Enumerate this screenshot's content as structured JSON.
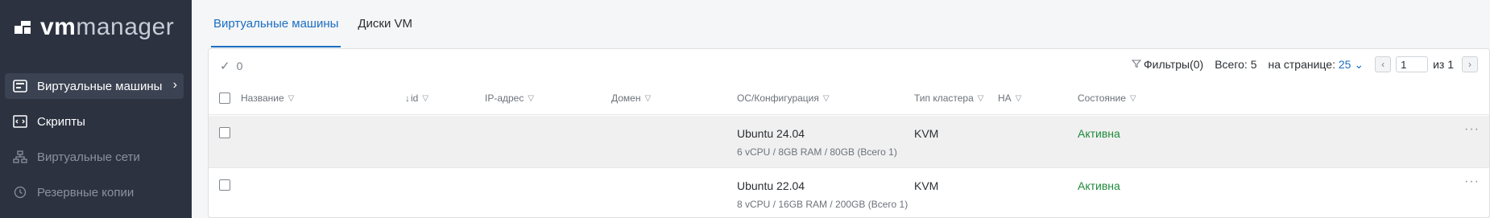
{
  "app": {
    "logo_vm": "vm",
    "logo_rest": "manager"
  },
  "sidebar": {
    "items": [
      {
        "label": "Виртуальные машины",
        "icon": "vm-icon",
        "active": true
      },
      {
        "label": "Скрипты",
        "icon": "script-icon"
      },
      {
        "label": "Виртуальные сети",
        "icon": "network-icon",
        "disabled": true
      },
      {
        "label": "Резервные копии",
        "icon": "backup-icon",
        "disabled": true
      }
    ]
  },
  "tabs": [
    {
      "label": "Виртуальные машины",
      "active": true
    },
    {
      "label": "Диски VM"
    }
  ],
  "toolbar": {
    "selected_count": "0",
    "filters_label": "Фильтры(0)",
    "total_label": "Всего: 5",
    "per_page_label": "на странице:",
    "per_page_value": "25",
    "page_value": "1",
    "of_label": "из",
    "total_pages": "1"
  },
  "table": {
    "columns": {
      "name": "Название",
      "id": "id",
      "ip": "IP-адрес",
      "domain": "Домен",
      "os": "ОС/Конфигурация",
      "cluster": "Тип кластера",
      "ha": "HA",
      "state": "Состояние"
    },
    "rows": [
      {
        "os": "Ubuntu 24.04",
        "config": "6 vCPU / 8GB RAM / 80GB (Всего 1)",
        "cluster": "KVM",
        "state": "Активна"
      },
      {
        "os": "Ubuntu 22.04",
        "config": "8 vCPU / 16GB RAM / 200GB (Всего 1)",
        "cluster": "KVM",
        "state": "Активна"
      }
    ]
  },
  "colors": {
    "sidebar_bg": "#2c3240",
    "accent": "#1b6ec2",
    "status_active": "#1e8a3c"
  }
}
